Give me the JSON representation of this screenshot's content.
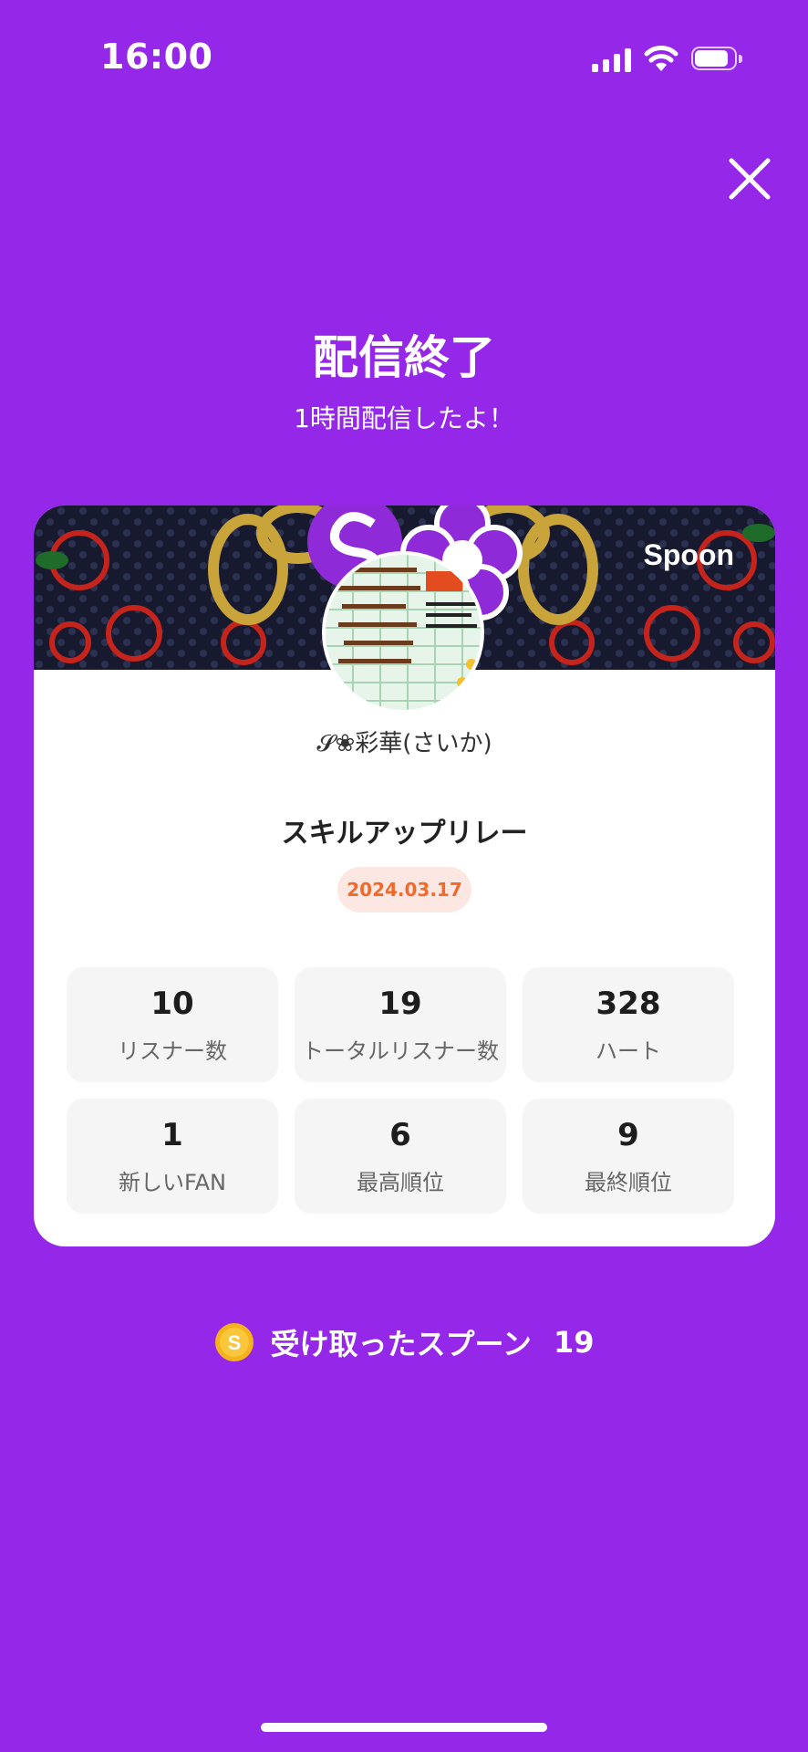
{
  "status_bar": {
    "time": "16:00",
    "icons": [
      "signal-icon",
      "wifi-icon",
      "battery-icon"
    ]
  },
  "header": {
    "title": "配信終了",
    "subtitle": "1時間配信したよ！"
  },
  "card": {
    "brand": "Spoon",
    "username": "𝓢❀彩華(さいか)",
    "broadcast_title": "スキルアップリレー",
    "date": "2024.03.17",
    "stats": [
      {
        "value": "10",
        "label": "リスナー数"
      },
      {
        "value": "19",
        "label": "トータルリスナー数"
      },
      {
        "value": "328",
        "label": "ハート"
      },
      {
        "value": "1",
        "label": "新しいFAN"
      },
      {
        "value": "6",
        "label": "最高順位"
      },
      {
        "value": "9",
        "label": "最終順位"
      }
    ]
  },
  "spoons": {
    "label": "受け取ったスプーン",
    "count": "19",
    "coin_symbol": "S"
  },
  "colors": {
    "background": "#9427e8",
    "date_badge_bg": "#fde7e2",
    "date_badge_text": "#f06a2a",
    "coin": "#f5b21b"
  }
}
